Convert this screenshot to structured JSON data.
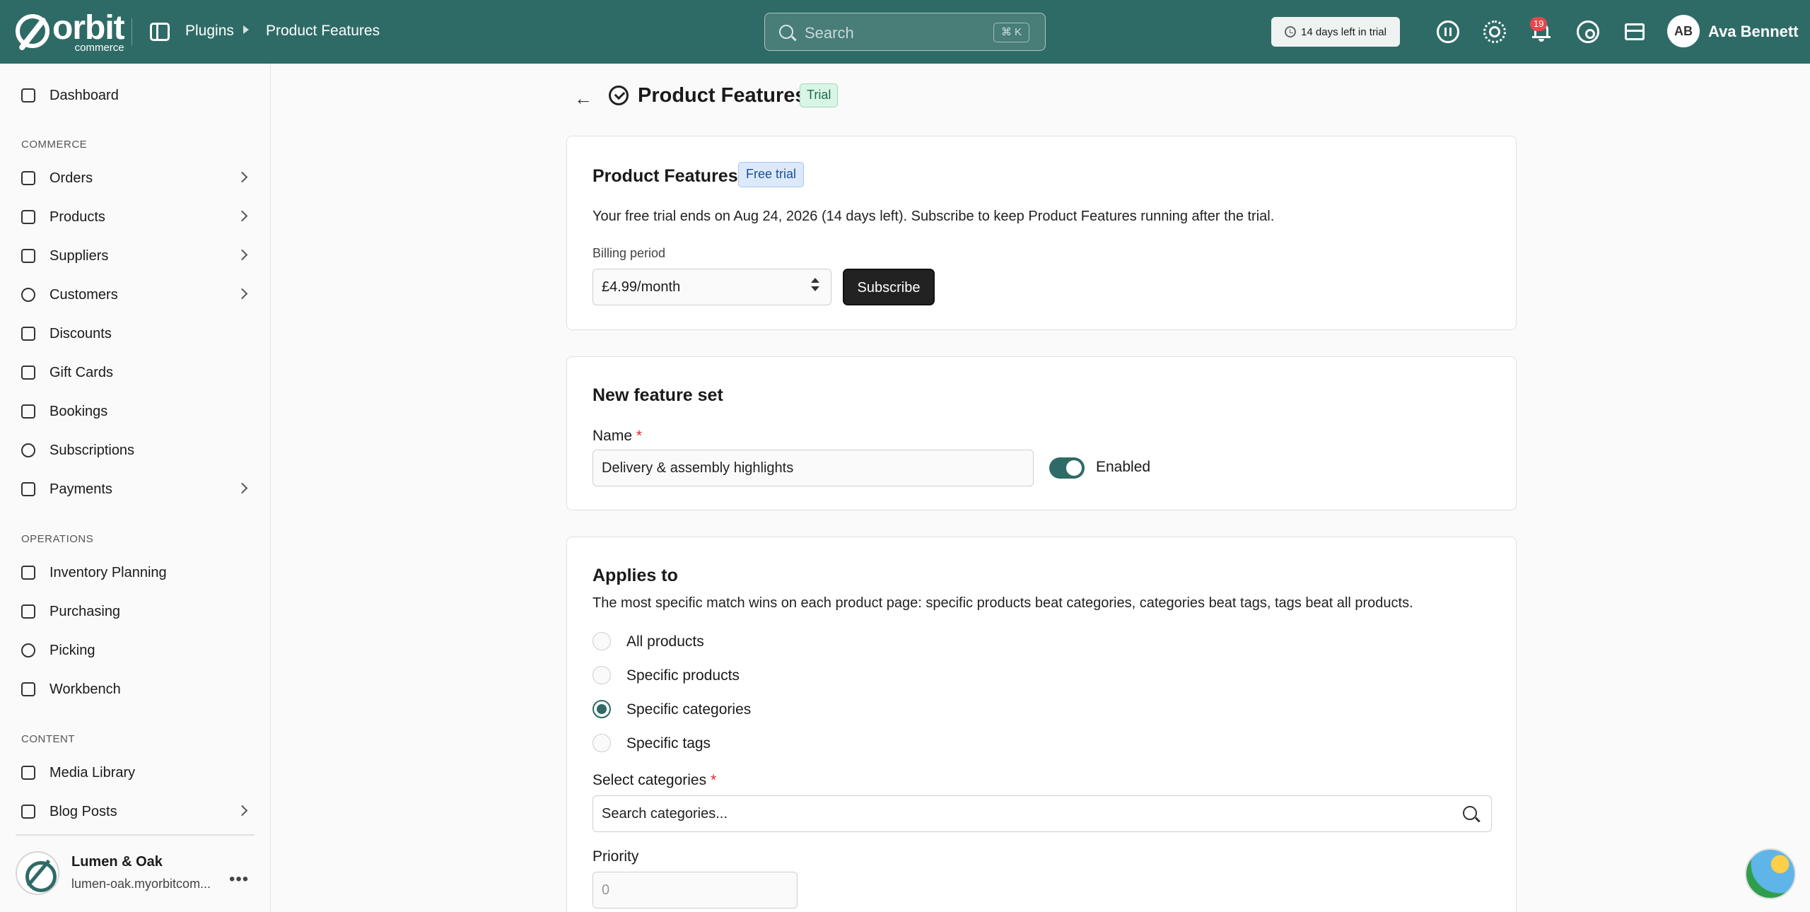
{
  "topbar": {
    "logo_word": "orbit",
    "logo_sub": "commerce",
    "breadcrumb": [
      "Plugins",
      "Product Features"
    ],
    "search_placeholder": "Search",
    "search_shortcut": "⌘ K",
    "trial_chip": "14 days left in trial",
    "notification_count": "19",
    "user_initials": "AB",
    "user_name": "Ava Bennett"
  },
  "sidebar": {
    "dashboard": "Dashboard",
    "sections": [
      "COMMERCE",
      "OPERATIONS",
      "CONTENT"
    ],
    "commerce_items": [
      "Orders",
      "Products",
      "Suppliers",
      "Customers",
      "Discounts",
      "Gift Cards",
      "Bookings",
      "Subscriptions",
      "Payments"
    ],
    "operations_items": [
      "Inventory Planning",
      "Purchasing",
      "Picking",
      "Workbench"
    ],
    "content_items": [
      "Media Library",
      "Blog Posts"
    ],
    "store_name": "Lumen & Oak",
    "store_url": "lumen-oak.myorbitcom..."
  },
  "page": {
    "title": "Product Features",
    "status_badge": "Trial"
  },
  "subscription_card": {
    "title": "Product Features",
    "badge": "Free trial",
    "message": "Your free trial ends on Aug 24, 2026 (14 days left). Subscribe to keep Product Features running after the trial.",
    "billing_label": "Billing period",
    "billing_value": "£4.99/month",
    "subscribe_label": "Subscribe"
  },
  "feature_set_card": {
    "title": "New feature set",
    "name_label": "Name",
    "required_mark": "*",
    "name_value": "Delivery & assembly highlights",
    "toggle_label": "Enabled",
    "enabled": true
  },
  "applies_card": {
    "title": "Applies to",
    "description": "The most specific match wins on each product page: specific products beat categories, categories beat tags, tags beat all products.",
    "options": [
      "All products",
      "Specific products",
      "Specific categories",
      "Specific tags"
    ],
    "selected_option": "Specific categories",
    "categories_label": "Select categories",
    "categories_placeholder": "Search categories...",
    "priority_label": "Priority",
    "priority_placeholder": "0"
  },
  "colors": {
    "brand": "#2f6b66",
    "danger": "#e5484d"
  }
}
